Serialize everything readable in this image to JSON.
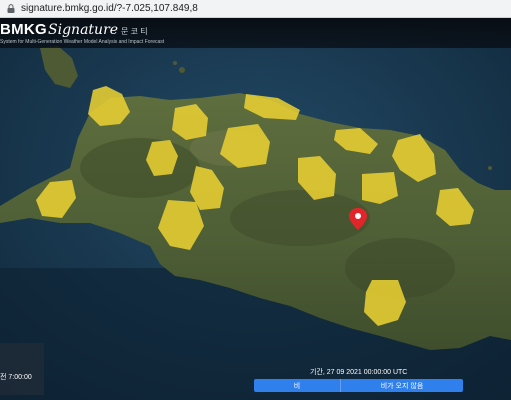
{
  "browser": {
    "url": "signature.bmkg.go.id/?-7.025,107.849,8"
  },
  "header": {
    "brand_main": "BMKG",
    "brand_sub": "Signature",
    "brand_extra": "문 코 티 ",
    "tagline": "System for Multi-Generation Weather Model Analysis and Impact Forecast"
  },
  "time_panel": {
    "label": "전 7:00:00"
  },
  "footer": {
    "period_label": "기간, 27 09 2021 00:00:00 UTC",
    "left_button": "비",
    "right_button": "비가 오지 않음"
  },
  "colors": {
    "hazard_fill": "#e8cf32",
    "marker": "#e2252b",
    "button": "#2f80ed"
  }
}
